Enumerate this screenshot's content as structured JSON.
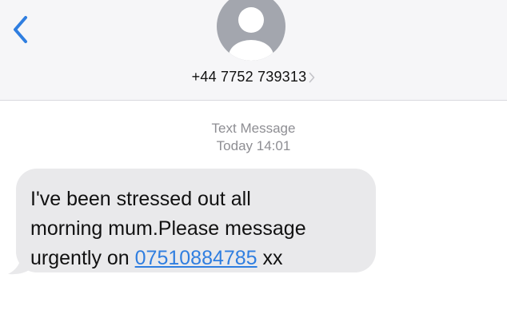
{
  "header": {
    "back_icon": "chevron-left-icon",
    "avatar_icon": "person-icon",
    "contact_number": "+44 7752 739313",
    "accent_color": "#2f7ee0"
  },
  "conversation": {
    "service_label": "Text Message",
    "timestamp": "Today 14:01"
  },
  "message": {
    "line1": "I've been stressed out all",
    "line2": "morning mum.Please message",
    "line3_prefix": "urgently on ",
    "link": "07510884785",
    "line3_suffix": " xx",
    "bubble_color": "#e9e9eb"
  }
}
